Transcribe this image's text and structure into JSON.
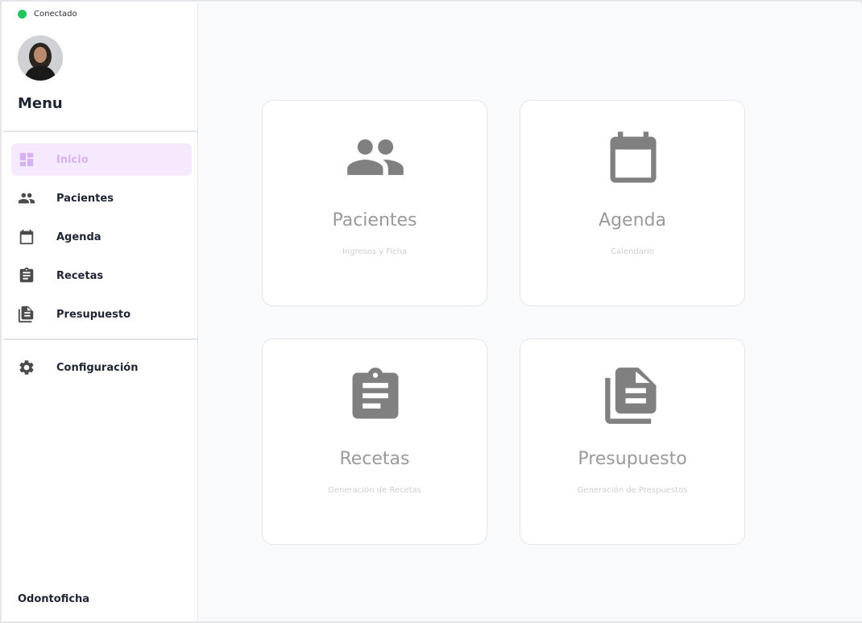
{
  "status": {
    "label": "Conectado",
    "color": "#22c55e"
  },
  "sidebar": {
    "menu_title": "Menu",
    "items": [
      {
        "label": "Inicio",
        "icon": "dashboard-icon",
        "active": true
      },
      {
        "label": "Pacientes",
        "icon": "people-icon"
      },
      {
        "label": "Agenda",
        "icon": "calendar-icon"
      },
      {
        "label": "Recetas",
        "icon": "clipboard-icon"
      },
      {
        "label": "Presupuesto",
        "icon": "document-icon"
      }
    ],
    "settings": {
      "label": "Configuración",
      "icon": "gear-icon"
    },
    "brand": "Odontoficha"
  },
  "cards": [
    {
      "title": "Pacientes",
      "subtitle": "Ingresos y Ficha",
      "icon": "people-icon"
    },
    {
      "title": "Agenda",
      "subtitle": "Calendario",
      "icon": "calendar-icon"
    },
    {
      "title": "Recetas",
      "subtitle": "Generación de Recetas",
      "icon": "clipboard-icon"
    },
    {
      "title": "Presupuesto",
      "subtitle": "Generación de Prespuestos",
      "icon": "document-icon"
    }
  ],
  "colors": {
    "accent": "#d6b1f2",
    "active_bg": "#f4e9fd",
    "icon_gray": "#808080",
    "sidebar_icon": "#4b4b4b"
  }
}
